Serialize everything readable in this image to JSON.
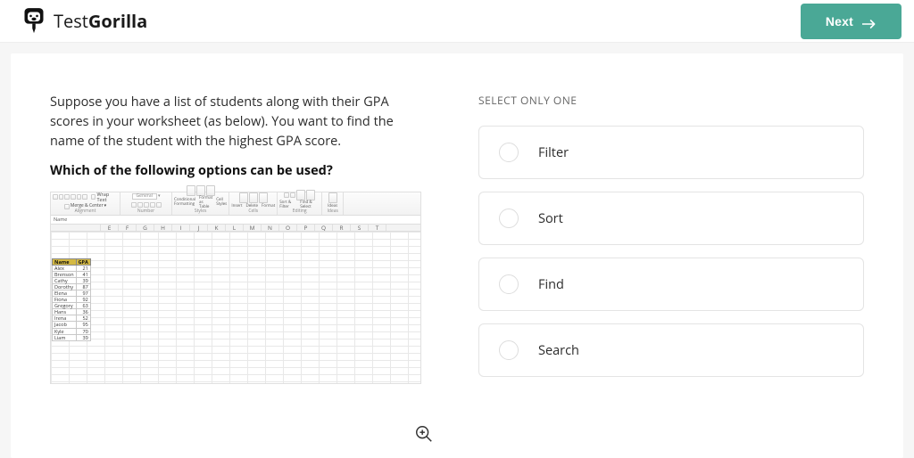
{
  "header": {
    "logo_text_a": "Test",
    "logo_text_b": "Gorilla",
    "next_label": "Next"
  },
  "question": {
    "prompt": "Suppose you have a list of students along with their GPA scores in your worksheet (as below). You want to find the name of the student with the highest GPA score.",
    "subprompt": "Which of the following options can be used?",
    "instruction": "SELECT ONLY ONE",
    "options": [
      {
        "label": "Filter"
      },
      {
        "label": "Sort"
      },
      {
        "label": "Find"
      },
      {
        "label": "Search"
      }
    ]
  },
  "excel": {
    "ribbon_groups": [
      "Alignment",
      "Number",
      "Styles",
      "Cells",
      "Editing",
      "Ideas"
    ],
    "wrap_text": "Wrap Text",
    "merge_center": "Merge & Center",
    "number_format": "General",
    "cond_fmt": "Conditional Formatting",
    "fmt_table": "Format as Table",
    "cell_styles": "Cell Styles",
    "insert": "Insert",
    "delete": "Delete",
    "format": "Format",
    "sort_filter": "Sort & Filter",
    "find_select": "Find & Select",
    "ideas": "Ideas",
    "namebox": "Name",
    "columns": [
      "E",
      "F",
      "G",
      "H",
      "I",
      "J",
      "K",
      "L",
      "M",
      "N",
      "O",
      "P",
      "Q",
      "R",
      "S",
      "T"
    ],
    "headers": [
      "Name",
      "GPA"
    ],
    "rows": [
      [
        "Alex",
        "21"
      ],
      [
        "Brenson",
        "41"
      ],
      [
        "Cathy",
        "39"
      ],
      [
        "Dorothy",
        "87"
      ],
      [
        "Elena",
        "97"
      ],
      [
        "Fiona",
        "92"
      ],
      [
        "Gregory",
        "63"
      ],
      [
        "Hans",
        "36"
      ],
      [
        "Irena",
        "52"
      ],
      [
        "Jacob",
        "95"
      ],
      [
        "Kyle",
        "70"
      ],
      [
        "Liam",
        "39"
      ]
    ]
  }
}
